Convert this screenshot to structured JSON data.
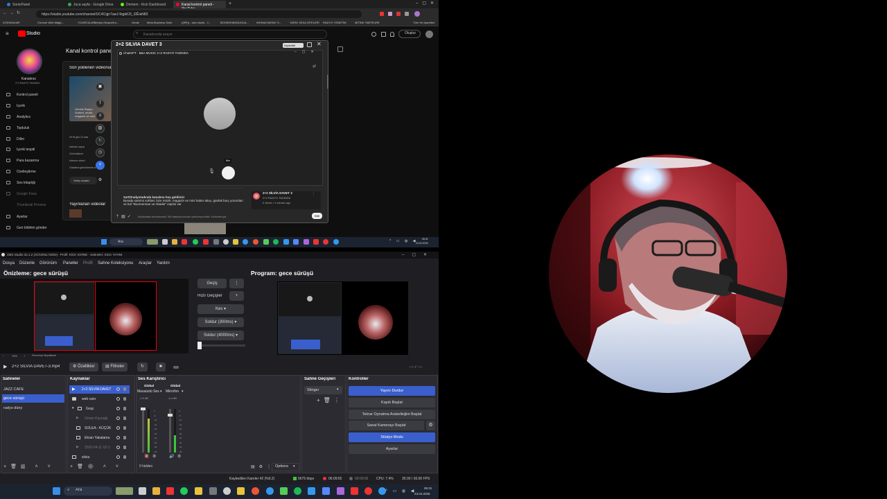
{
  "browser": {
    "tabs": [
      {
        "label": "SonicPanel",
        "color": "#2e7bd6"
      },
      {
        "label": "Juca sayfa - Google Drive",
        "color": "#34a853"
      },
      {
        "label": "Dnmem - Kick Dashboard",
        "color": "#53fc18"
      },
      {
        "label": "Kanal kontrol paneli - YouTube",
        "color": "#ff0033"
      }
    ],
    "url": "https://studio.youtube.com/channel/UC4Cqjn7uwJ-9qpkfJ3_I2Ê/aN83",
    "bookmarks": [
      "KODVANLAR",
      "Chrome Web Mağa...",
      "YOURCÜLAR",
      "Medya Oluştur/Ko...",
      "Gmail",
      "Meta Business Suite",
      "((RR)) - radı müzik - Y...",
      "BOOMSHAKNUGUA...",
      "WHHAKOMSAY S...",
      "YAPAY ZEKA SİTELERİ",
      "RADYO YÖNETİM",
      "MİTİNK TABTEURE",
      "Tüm Yer İşaretleri"
    ]
  },
  "yt": {
    "studio_label": "Studio",
    "search_placeholder": "Kanalınızda arayın",
    "create_label": "Oluştur",
    "channel_name": "Kanalınız",
    "channel_sub": "2+2 RADYO TADINDA",
    "nav": [
      "Kontrol paneli",
      "İçerik",
      "Analytics",
      "Topluluk",
      "Diller",
      "İçerik tespiti",
      "Para kazanma",
      "Özelleştirme",
      "Ses kitaplığı",
      "Google Kasa",
      "Thumbnail Preview"
    ],
    "nav_bottom": [
      "Ayarlar",
      "Geri bildirim gönder"
    ],
    "dashboard_title": "Kanal kontrol paneli",
    "recent_label": "Son yüklenen videonun performansı",
    "published_label": "Yayınlanan videolar",
    "upload_label": "Video yükle",
    "video_title": "Günlük Radyo: Sohbet, müzik, magazin ve mini haber",
    "rows": [
      "İzlenme sayısı",
      "Görüntüleme",
      "İzlenme süresi",
      "Ortalama görüntüleme süresi"
    ],
    "small_items": [
      "25 Ni gün 13 saat",
      "Video analizi"
    ]
  },
  "popup": {
    "title": "2+2 SİLVİA DAVET 3",
    "saved_badge": "Kaydedildi",
    "inner_title": "ChatGPT · B&A MUSIC 2+2 RADYO TADINDA",
    "mic_tooltip": "Bitir",
    "desc_line1": "2art/2radyotadında kanalına hoş geldiniz!",
    "desc_line2": "Burada samimi sohbet, bize müzik, magazin ve mini haber akışı, günlük burç yorumları ve bol \"Boomerman ve Abadie\" esprisi var",
    "video_card_title": "2+2 SİLVİA DAVET 3",
    "video_card_channel": "2+2 RADYO TADINDA",
    "video_card_meta": "0 views • 1 minute ago",
    "bottom_note": "Kısıtlamalar tanımlanmadı. Telif hakkıyla korunan içerik tespit edildi. Kontrolleri gör",
    "save_btn": "Bitti"
  },
  "taskbar_top": {
    "search": "Ara",
    "time": "06:31",
    "date": "23.04.2026"
  },
  "obs": {
    "title": "OBS Studio 32.1.2 (GÜVENLİ MOD) - Profil: KİCK SİVİNE - Sahneler: KICK YAYINI",
    "menu": [
      "Dosya",
      "Düzenle",
      "Görünüm",
      "Paneller",
      "Profil",
      "Sahne Koleksiyonu",
      "Araçlar",
      "Yardım"
    ],
    "preview_label": "Önizleme: gece sürüşü",
    "program_label": "Program: gece sürüşü",
    "transition_btn": "Geçiş",
    "quick_transitions": "Hızlı Geçişler",
    "cut": "Kes",
    "fade300": "Soldur (300ms)",
    "fade4000": "Soldur (4000ms)",
    "zoom": "19%",
    "scale_label": "Pencereye Boyutlandır",
    "media_title": "2+2 SİLVİA DAVET-3.mp4",
    "properties": "Özellikler",
    "filters": "Filtreler",
    "timecode": "-:-:- / -:-:-",
    "docks": {
      "scenes": "Sahneler",
      "sources": "Kaynaklar",
      "mixer": "Ses Karıştırıcı",
      "transitions": "Sahne Geçişleri",
      "controls": "Kontroller"
    },
    "scenes": [
      "JAZZ CAFE",
      "gece sürüşü",
      "radyo düny"
    ],
    "sources": [
      "2+2 SİLVİA DAVET",
      "web cam",
      "Grup",
      "Ortam Kaynağı",
      "SOLEA - KÜÇÜK",
      "Ekran Yakalama",
      "2026-04-11 02-1",
      "silvia"
    ],
    "mixer": {
      "ch1_group": "Global",
      "ch1_name": "Masaüstü Ses",
      "ch1_db": "-1.0 dB",
      "ch2_group": "Global",
      "ch2_name": "Mikrofon",
      "ch2_db": "-4.4 dB",
      "hidden": "0 hidden"
    },
    "transition_select": "Stinger",
    "controls": [
      "Yayını Durdur",
      "Kaydı Başlat",
      "Tekrar Oynatma Arabelleğini Başlat",
      "Sanal Kamerayı Başlat",
      "Stüdyo Modu",
      "Ayarlar"
    ],
    "options": "Options",
    "status": {
      "dropped": "Kaybedilen Kareler 42 (%0.2)",
      "bitrate": "5675 kbps",
      "stream_time": "06:09:55",
      "rec_time": "00:00:00",
      "cpu": "CPU: 7.4%",
      "fps": "30.00 / 30.00 FPS"
    }
  },
  "taskbar_bottom": {
    "search": "Ara",
    "time": "06:31",
    "date": "23.04.2026"
  }
}
